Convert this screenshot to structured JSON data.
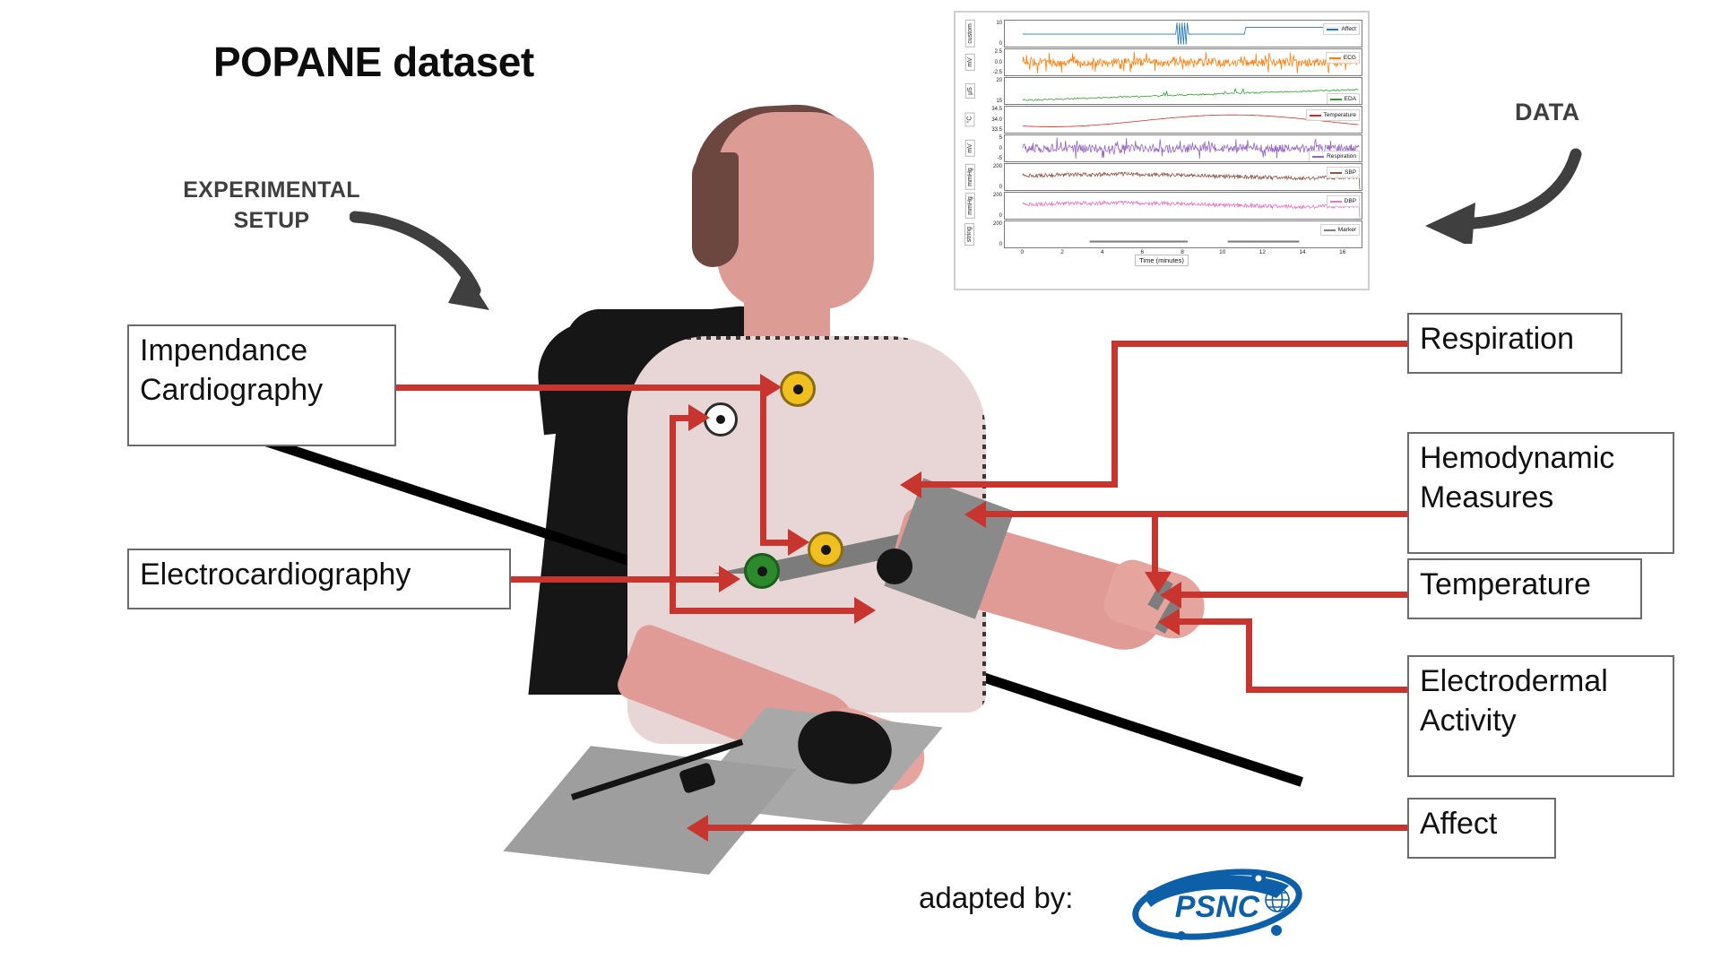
{
  "title": "POPANE dataset",
  "annotations": {
    "experimental_setup": "EXPERIMENTAL\nSETUP",
    "experimental_setup_line1": "EXPERIMENTAL",
    "experimental_setup_line2": "SETUP",
    "data": "DATA"
  },
  "callouts": {
    "icg_line1": "Impendance",
    "icg_line2": "Cardiography",
    "ecg": "Electrocardiography",
    "respiration": "Respiration",
    "hemodynamic_line1": "Hemodynamic",
    "hemodynamic_line2": "Measures",
    "temperature": "Temperature",
    "eda_line1": "Electrodermal",
    "eda_line2": "Activity",
    "affect": "Affect"
  },
  "footer": {
    "adapted_by": "adapted by:",
    "logo_text": "PSNC"
  },
  "colors": {
    "connector_red": "#c8352f",
    "annotation_grey": "#3f3f3f",
    "logo_blue": "#0d5fa8",
    "skin": "#dd9b95",
    "shirt": "#e8d5d6",
    "hair": "#6b4740"
  },
  "electrodes": [
    {
      "name": "icg-upper-electrode",
      "color": "#f0c020"
    },
    {
      "name": "icg-white-electrode",
      "color": "#ffffff"
    },
    {
      "name": "icg-lower-electrode",
      "color": "#f0c020"
    },
    {
      "name": "ecg-green-electrode",
      "color": "#2c8a2c"
    },
    {
      "name": "ecg-black-electrode",
      "color": "#161616"
    }
  ],
  "chart_data": {
    "type": "line",
    "title": "",
    "xlabel": "Time (minutes)",
    "xticks": [
      0,
      2,
      4,
      6,
      8,
      10,
      12,
      14,
      16
    ],
    "xlim": [
      -0.6,
      16.8
    ],
    "grid": false,
    "legend_position": "inside-top-right",
    "panels": [
      {
        "legend": "Affect",
        "ylabel": "custom",
        "color": "#2077b4",
        "yticks": [
          "10",
          "0"
        ],
        "ylim": [
          0,
          11
        ],
        "signal": "step",
        "description": "Continuous self-reported affect rating; flat ~5, sharp spike near minute 6, step up to ~8 after minute 10"
      },
      {
        "legend": "ECG",
        "ylabel": "mV",
        "color": "#ff7f0e",
        "yticks": [
          "2.5",
          "0.0",
          "-2.5"
        ],
        "ylim": [
          -3.2,
          3.2
        ],
        "signal": "noise-dense",
        "description": "Electrocardiogram, dense R-peak band between -2.5 and 2.5 mV"
      },
      {
        "legend": "EDA",
        "ylabel": "µS",
        "color": "#2ca02c",
        "yticks": [
          "20",
          "15"
        ],
        "ylim": [
          13,
          21
        ],
        "signal": "slow-rise",
        "description": "Electrodermal activity rising from ~14 to ~18 µS with phasic peaks"
      },
      {
        "legend": "Temperature",
        "ylabel": "°C",
        "color": "#d62728",
        "yticks": [
          "34.5",
          "34.0",
          "33.5"
        ],
        "ylim": [
          33.3,
          34.7
        ],
        "signal": "smooth-wave",
        "description": "Skin temperature oscillating between 33.5 and 34.5 °C"
      },
      {
        "legend": "Respiration",
        "ylabel": "mV",
        "color": "#9467bd",
        "yticks": [
          "5",
          "0",
          "-5"
        ],
        "ylim": [
          -7,
          7
        ],
        "signal": "noise-dense",
        "description": "Respiration belt signal with occasional large deflections"
      },
      {
        "legend": "SBP",
        "ylabel": "mmHg",
        "color": "#8c564b",
        "yticks": [
          "200",
          "0"
        ],
        "ylim": [
          0,
          220
        ],
        "signal": "noise-band",
        "description": "Systolic blood pressure band around 120-140 mmHg, drops to 0 at the end"
      },
      {
        "legend": "DBP",
        "ylabel": "mmHg",
        "color": "#e377c2",
        "yticks": [
          "200",
          "0"
        ],
        "ylim": [
          0,
          220
        ],
        "signal": "noise-band",
        "description": "Diastolic blood pressure band around 70-90 mmHg, drops to 0 at the end"
      },
      {
        "legend": "Marker",
        "ylabel": "string",
        "color": "#7f7f7f",
        "yticks": [
          "200",
          "0"
        ],
        "ylim": [
          0,
          220
        ],
        "signal": "marker-bars",
        "description": "Event marker track: grey segments near minutes 3.5-8.5 and 9.5-12.5"
      }
    ]
  }
}
